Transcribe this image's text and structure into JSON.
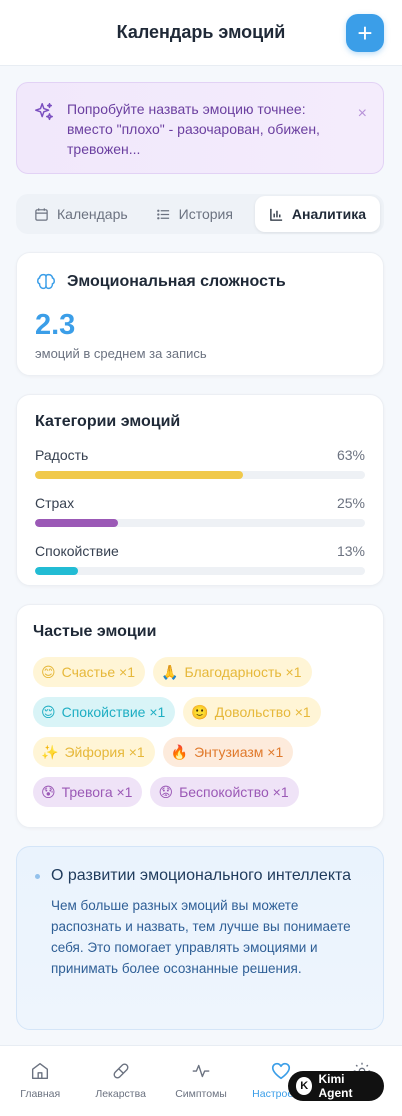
{
  "header": {
    "title": "Календарь эмоций",
    "add_label": "+"
  },
  "tip": {
    "text": "Попробуйте назвать эмоцию точнее: вместо \"плохо\" - разочарован, обижен, тревожен...",
    "close": "×"
  },
  "tabs": [
    {
      "label": "Календарь",
      "icon": "calendar-icon"
    },
    {
      "label": "История",
      "icon": "list-icon"
    },
    {
      "label": "Аналитика",
      "icon": "bar-chart-icon"
    }
  ],
  "complexity": {
    "title": "Эмоциональная сложность",
    "value": "2.3",
    "subtitle": "эмоций в среднем за запись"
  },
  "categories": {
    "title": "Категории эмоций",
    "items": [
      {
        "label": "Радость",
        "pct_label": "63%",
        "pct": 63,
        "color": "#f0c94b"
      },
      {
        "label": "Страх",
        "pct_label": "25%",
        "pct": 25,
        "color": "#9b59b6"
      },
      {
        "label": "Спокойствие",
        "pct_label": "13%",
        "pct": 13,
        "color": "#22bcd4"
      }
    ]
  },
  "frequent": {
    "title": "Частые эмоции",
    "chips": [
      {
        "emoji": "😊",
        "label": "Счастье ×1",
        "bg": "#fff5d6",
        "fg": "#e6b83a"
      },
      {
        "emoji": "🙏",
        "label": "Благодарность ×1",
        "bg": "#fff5d6",
        "fg": "#e6b83a"
      },
      {
        "emoji": "😌",
        "label": "Спокойствие ×1",
        "bg": "#d9f4f7",
        "fg": "#1eaec3"
      },
      {
        "emoji": "🙂",
        "label": "Довольство ×1",
        "bg": "#fff5d6",
        "fg": "#e6b83a"
      },
      {
        "emoji": "✨",
        "label": "Эйфория ×1",
        "bg": "#fff5d6",
        "fg": "#e6b83a"
      },
      {
        "emoji": "🔥",
        "label": "Энтузиазм ×1",
        "bg": "#fdebdc",
        "fg": "#e07a2c"
      },
      {
        "emoji": "😰",
        "label": "Тревога ×1",
        "bg": "#efe3f7",
        "fg": "#9b59b6"
      },
      {
        "emoji": "😟",
        "label": "Беспокойство ×1",
        "bg": "#efe3f7",
        "fg": "#9b59b6"
      }
    ]
  },
  "info": {
    "title": "О развитии эмоционального интеллекта",
    "text": "Чем больше разных эмоций вы можете распознать и назвать, тем лучше вы понимаете себя. Это помогает управлять эмоциями и принимать более осознанные решения."
  },
  "nav": [
    {
      "label": "Главная",
      "icon": "home-icon"
    },
    {
      "label": "Лекарства",
      "icon": "pill-icon"
    },
    {
      "label": "Симптомы",
      "icon": "pulse-icon"
    },
    {
      "label": "Настроение",
      "icon": "heart-icon",
      "active": true
    },
    {
      "label": "",
      "icon": "settings-icon"
    }
  ],
  "badge": {
    "label": "Kimi Agent",
    "logo": "K"
  },
  "colors": {
    "accent": "#3b9ee8",
    "tip_text": "#6b3fa0"
  }
}
